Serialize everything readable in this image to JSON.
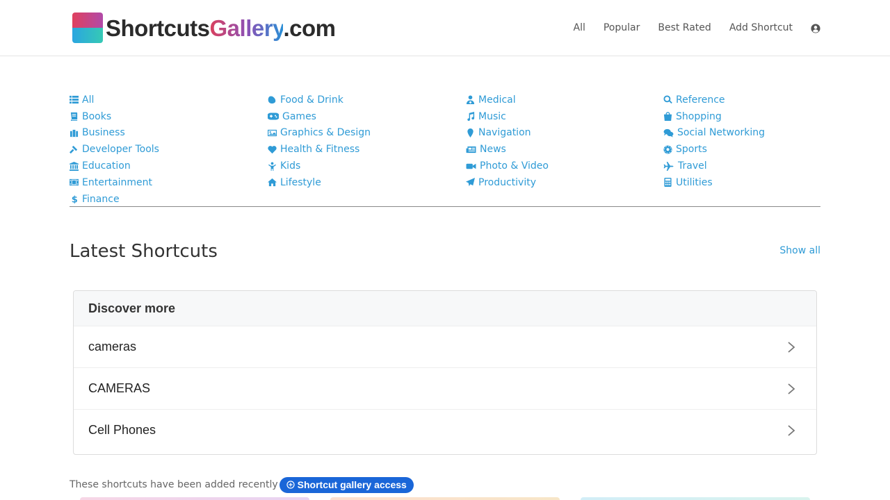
{
  "header": {
    "logo_prefix": "Shortcuts",
    "logo_accent": "Gallery",
    "logo_suffix": ".com",
    "nav": [
      "All",
      "Popular",
      "Best Rated",
      "Add Shortcut"
    ],
    "user_icon": "user-circle-icon"
  },
  "categories": {
    "col1": [
      {
        "label": "All",
        "icon": "list-icon"
      },
      {
        "label": "Books",
        "icon": "book-icon"
      },
      {
        "label": "Business",
        "icon": "briefcase-icon"
      },
      {
        "label": "Developer Tools",
        "icon": "hammer-icon"
      },
      {
        "label": "Education",
        "icon": "university-icon"
      },
      {
        "label": "Entertainment",
        "icon": "film-icon"
      },
      {
        "label": "Finance",
        "icon": "dollar-icon"
      }
    ],
    "col2": [
      {
        "label": "Food & Drink",
        "icon": "lemon-icon"
      },
      {
        "label": "Games",
        "icon": "gamepad-icon"
      },
      {
        "label": "Graphics & Design",
        "icon": "image-icon"
      },
      {
        "label": "Health & Fitness",
        "icon": "heart-icon"
      },
      {
        "label": "Kids",
        "icon": "child-icon"
      },
      {
        "label": "Lifestyle",
        "icon": "home-icon"
      }
    ],
    "col3": [
      {
        "label": "Medical",
        "icon": "doctor-icon"
      },
      {
        "label": "Music",
        "icon": "music-icon"
      },
      {
        "label": "Navigation",
        "icon": "map-marker-icon"
      },
      {
        "label": "News",
        "icon": "newspaper-icon"
      },
      {
        "label": "Photo & Video",
        "icon": "video-icon"
      },
      {
        "label": "Productivity",
        "icon": "paper-plane-icon"
      }
    ],
    "col4": [
      {
        "label": "Reference",
        "icon": "search-icon"
      },
      {
        "label": "Shopping",
        "icon": "shopping-bag-icon"
      },
      {
        "label": "Social Networking",
        "icon": "comments-icon"
      },
      {
        "label": "Sports",
        "icon": "soccer-ball-icon"
      },
      {
        "label": "Travel",
        "icon": "plane-icon"
      },
      {
        "label": "Utilities",
        "icon": "calculator-icon"
      }
    ]
  },
  "latest": {
    "title": "Latest Shortcuts",
    "show_all": "Show all"
  },
  "discover": {
    "heading": "Discover more",
    "items": [
      "cameras",
      "CAMERAS",
      "Cell Phones"
    ]
  },
  "footer": {
    "text": "These shortcuts have been added recently",
    "access_button": "Shortcut gallery access"
  },
  "colors": {
    "link": "#2f9bd6",
    "button": "#1a66d8"
  }
}
